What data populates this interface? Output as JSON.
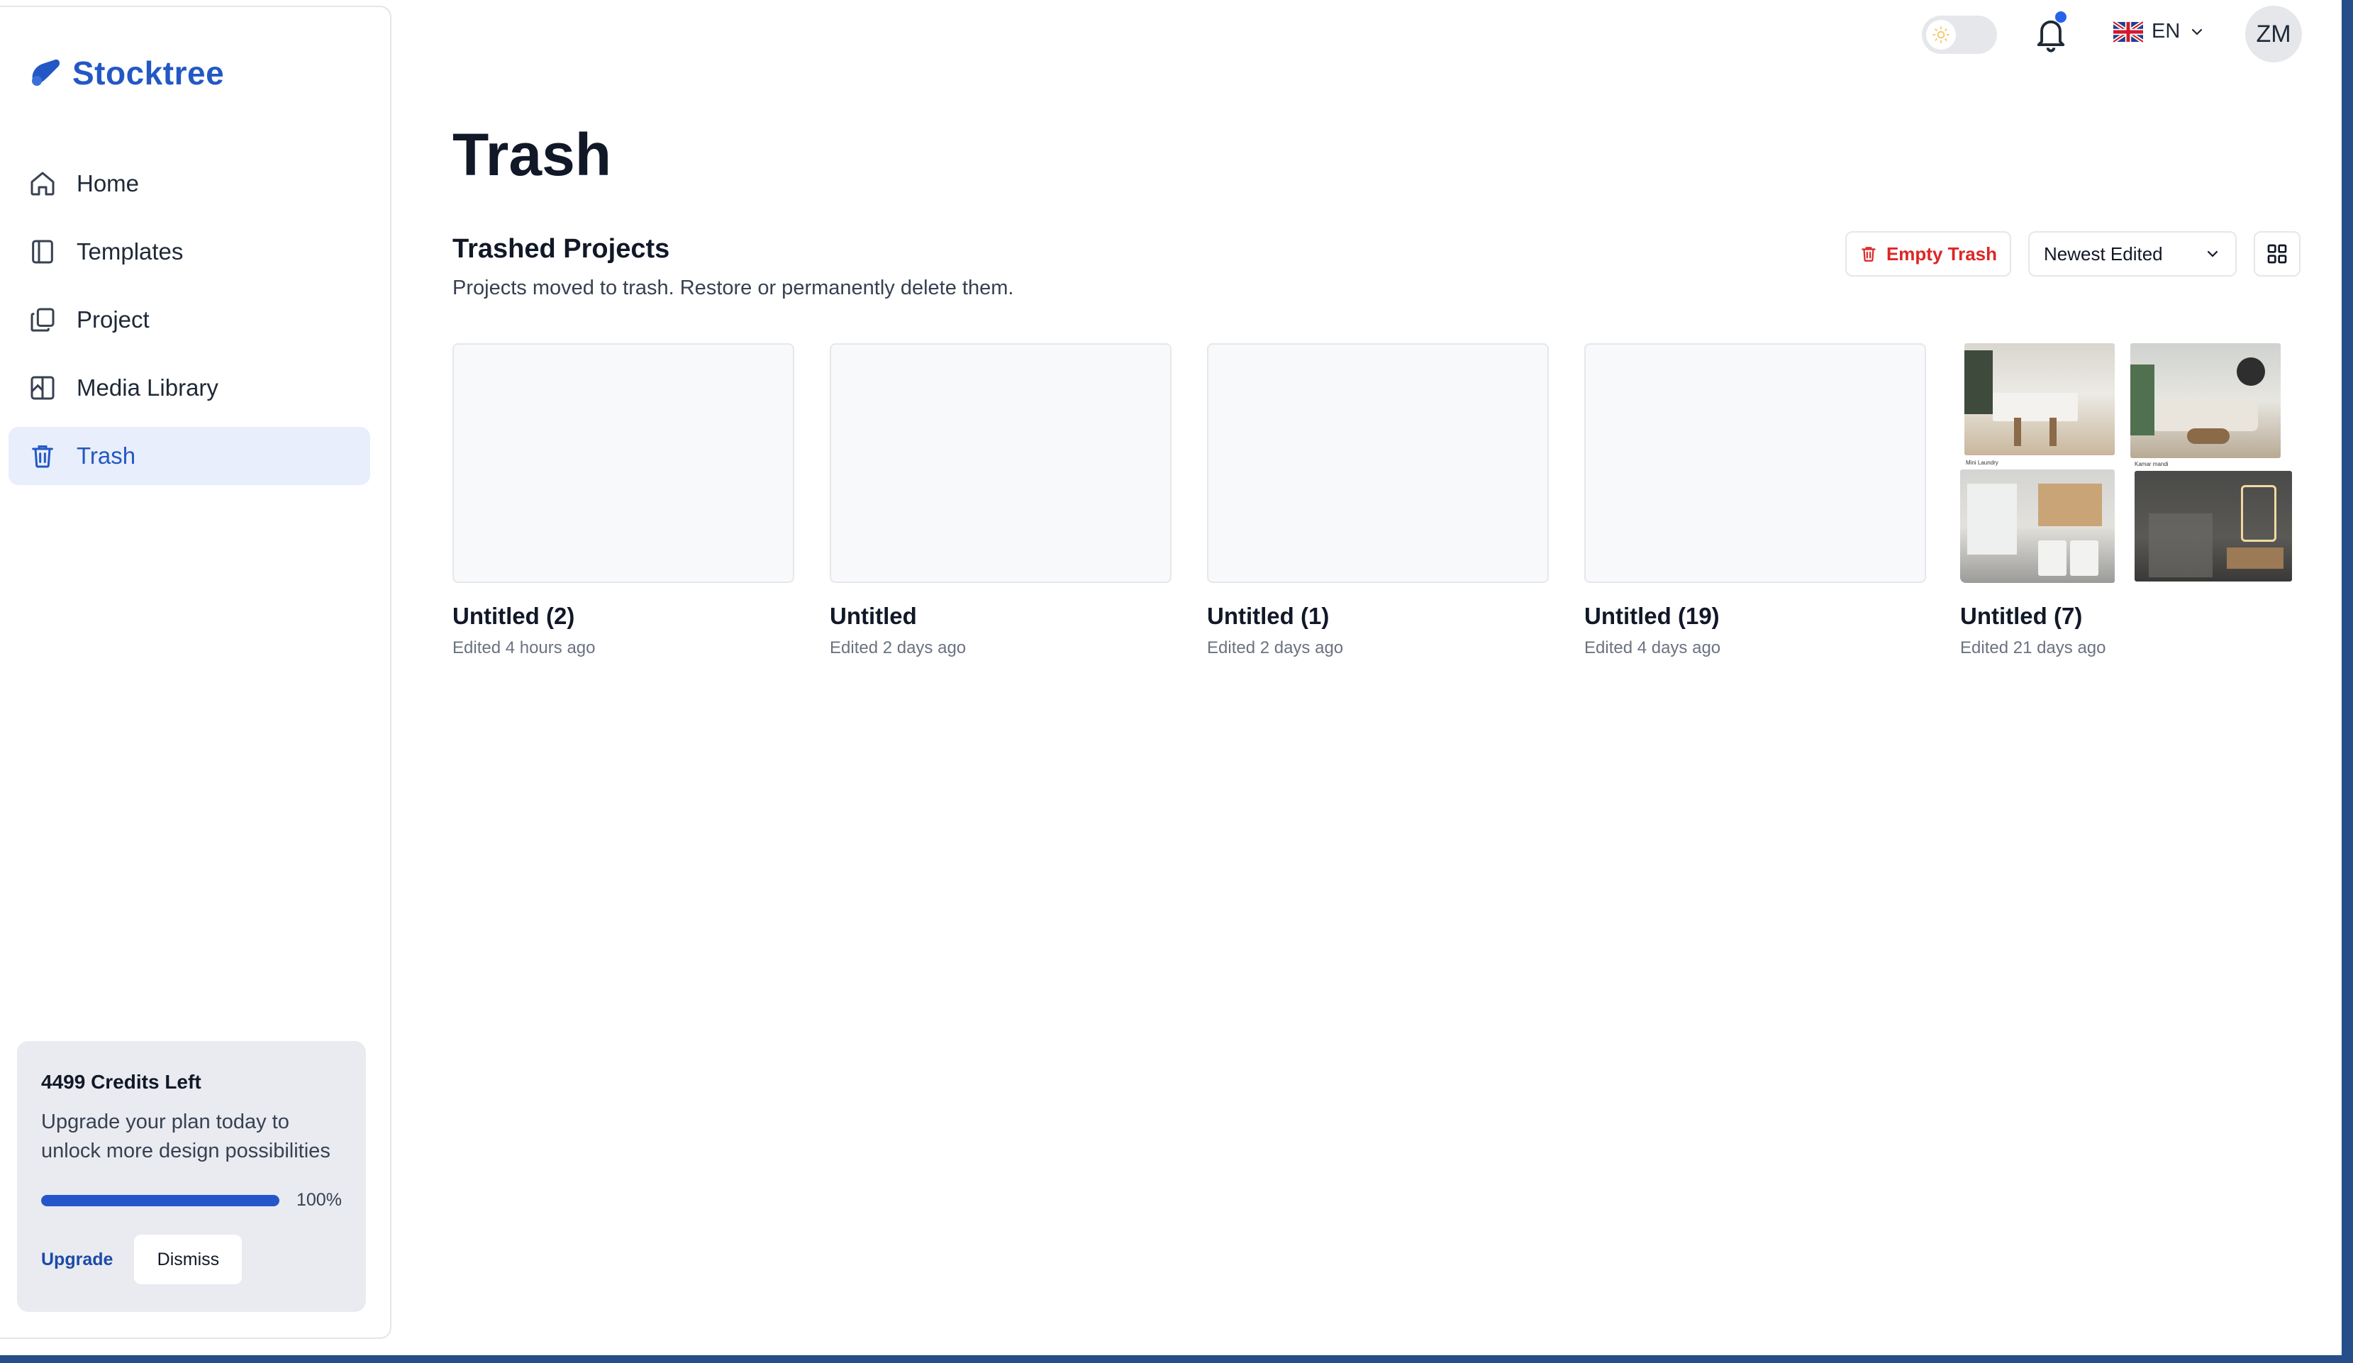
{
  "brand": {
    "name": "Stocktree",
    "color": "#2358c4"
  },
  "sidebar": {
    "items": [
      {
        "label": "Home",
        "icon": "home-icon"
      },
      {
        "label": "Templates",
        "icon": "templates-icon"
      },
      {
        "label": "Project",
        "icon": "project-icon"
      },
      {
        "label": "Media Library",
        "icon": "media-library-icon"
      },
      {
        "label": "Trash",
        "icon": "trash-icon",
        "active": true
      }
    ],
    "credits": {
      "title": "4499 Credits Left",
      "text": "Upgrade your plan today to unlock more design possibilities",
      "progress": 1.0,
      "progress_label": "100%",
      "upgrade_label": "Upgrade",
      "dismiss_label": "Dismiss"
    }
  },
  "topbar": {
    "theme_toggle_icon": "sun-icon",
    "notifications_icon": "bell-icon",
    "has_unread": true,
    "language": {
      "code": "EN",
      "flag": "uk-flag-icon"
    },
    "avatar_initials": "ZM"
  },
  "page": {
    "title": "Trash",
    "section_title": "Trashed Projects",
    "section_subtitle": "Projects moved to trash. Restore or permanently delete them.",
    "empty_trash_label": "Empty Trash",
    "sort": {
      "selected": "Newest Edited"
    },
    "view_icon": "grid-view-icon",
    "accent_danger": "#dc2626"
  },
  "projects": [
    {
      "title": "Untitled (2)",
      "meta": "Edited 4 hours ago"
    },
    {
      "title": "Untitled",
      "meta": "Edited 2 days ago"
    },
    {
      "title": "Untitled (1)",
      "meta": "Edited 2 days ago"
    },
    {
      "title": "Untitled (19)",
      "meta": "Edited 4 days ago"
    },
    {
      "title": "Untitled (7)",
      "meta": "Edited 21 days ago",
      "thumbnail_captions": [
        "Mini Laundry",
        "Kamar mandi"
      ]
    }
  ]
}
